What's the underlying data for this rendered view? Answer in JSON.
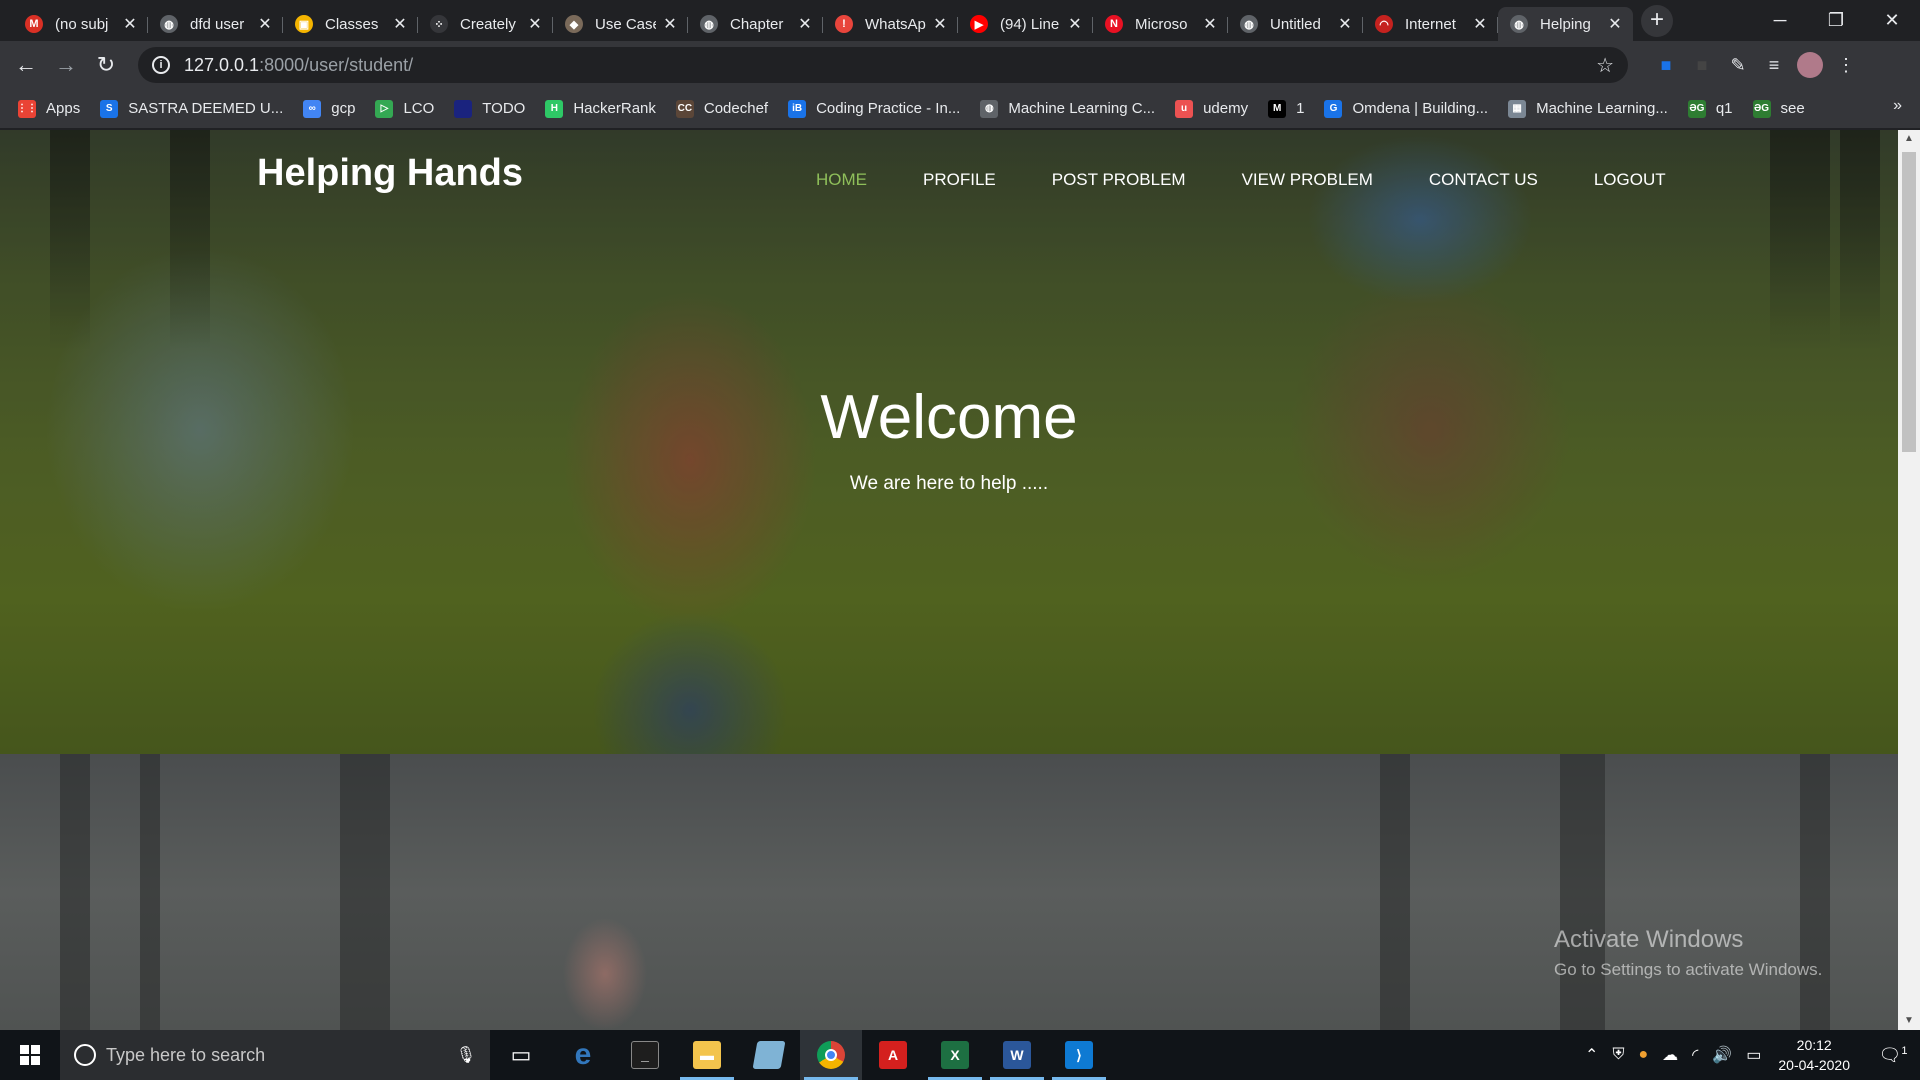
{
  "browser": {
    "tabs": [
      {
        "title": "(no subj",
        "fav": "gmail-icon",
        "color": "#d93025",
        "glyph": "M"
      },
      {
        "title": "dfd user",
        "fav": "globe-icon",
        "color": "#5f6368",
        "glyph": "◍"
      },
      {
        "title": "Classes",
        "fav": "classroom-icon",
        "color": "#f4b400",
        "glyph": "▣"
      },
      {
        "title": "Creately",
        "fav": "creately-icon",
        "color": "#35363a",
        "glyph": "⁘"
      },
      {
        "title": "Use Case",
        "fav": "use-case-icon",
        "color": "#7a6a5a",
        "glyph": "◆"
      },
      {
        "title": "Chapter",
        "fav": "globe-icon",
        "color": "#5f6368",
        "glyph": "◍"
      },
      {
        "title": "WhatsAp",
        "fav": "warning-icon",
        "color": "#e8453c",
        "glyph": "!"
      },
      {
        "title": "(94) Line",
        "fav": "youtube-icon",
        "color": "#ff0000",
        "glyph": "▶"
      },
      {
        "title": "Microso",
        "fav": "microsoft-icon",
        "color": "#e81123",
        "glyph": "N"
      },
      {
        "title": "Untitled",
        "fav": "globe-icon",
        "color": "#5f6368",
        "glyph": "◍"
      },
      {
        "title": "Internet",
        "fav": "internet-icon",
        "color": "#c5221f",
        "glyph": "◠"
      },
      {
        "title": "Helping",
        "fav": "globe-icon",
        "color": "#5f6368",
        "glyph": "◍",
        "active": true
      }
    ],
    "url_host": "127.0.0.1",
    "url_path": ":8000/user/student/",
    "bookmarks": [
      {
        "label": "Apps",
        "icon": "apps-icon",
        "color": "#ea4335",
        "glyph": "⋮⋮"
      },
      {
        "label": "SASTRA DEEMED U...",
        "icon": "sastra-icon",
        "color": "#1a73e8",
        "glyph": "S"
      },
      {
        "label": "gcp",
        "icon": "gcp-icon",
        "color": "#4285f4",
        "glyph": "∞"
      },
      {
        "label": "LCO",
        "icon": "lco-icon",
        "color": "#34a853",
        "glyph": "▷"
      },
      {
        "label": "TODO",
        "icon": "todo-icon",
        "color": "#1a237e",
        "glyph": ""
      },
      {
        "label": "HackerRank",
        "icon": "hackerrank-icon",
        "color": "#2ec866",
        "glyph": "H"
      },
      {
        "label": "Codechef",
        "icon": "codechef-icon",
        "color": "#5b4638",
        "glyph": "CC"
      },
      {
        "label": "Coding Practice - In...",
        "icon": "interviewbit-icon",
        "color": "#1a73e8",
        "glyph": "iB"
      },
      {
        "label": "Machine Learning C...",
        "icon": "globe-icon",
        "color": "#5f6368",
        "glyph": "◍"
      },
      {
        "label": "udemy",
        "icon": "udemy-icon",
        "color": "#ec5252",
        "glyph": "u"
      },
      {
        "label": "1",
        "icon": "medium-icon",
        "color": "#000000",
        "glyph": "M"
      },
      {
        "label": "Omdena | Building...",
        "icon": "omdena-icon",
        "color": "#1a73e8",
        "glyph": "G"
      },
      {
        "label": "Machine Learning...",
        "icon": "ml-icon",
        "color": "#7b8794",
        "glyph": "▦"
      },
      {
        "label": "q1",
        "icon": "q1-icon",
        "color": "#2e7d32",
        "glyph": "ƏG"
      },
      {
        "label": "see",
        "icon": "see-icon",
        "color": "#2e7d32",
        "glyph": "ƏG"
      }
    ]
  },
  "page": {
    "brand": "Helping Hands",
    "nav": [
      {
        "label": "HOME",
        "active": true
      },
      {
        "label": "PROFILE"
      },
      {
        "label": "POST PROBLEM"
      },
      {
        "label": "VIEW PROBLEM"
      },
      {
        "label": "CONTACT US"
      },
      {
        "label": "LOGOUT"
      }
    ],
    "hero_title": "Welcome",
    "hero_subtitle": "We are here to help .....",
    "accent_color": "#8fbf5a"
  },
  "watermark": {
    "line1": "Activate Windows",
    "line2": "Go to Settings to activate Windows."
  },
  "taskbar": {
    "search_placeholder": "Type here to search",
    "time": "20:12",
    "date": "20-04-2020",
    "notification_count": "1"
  }
}
